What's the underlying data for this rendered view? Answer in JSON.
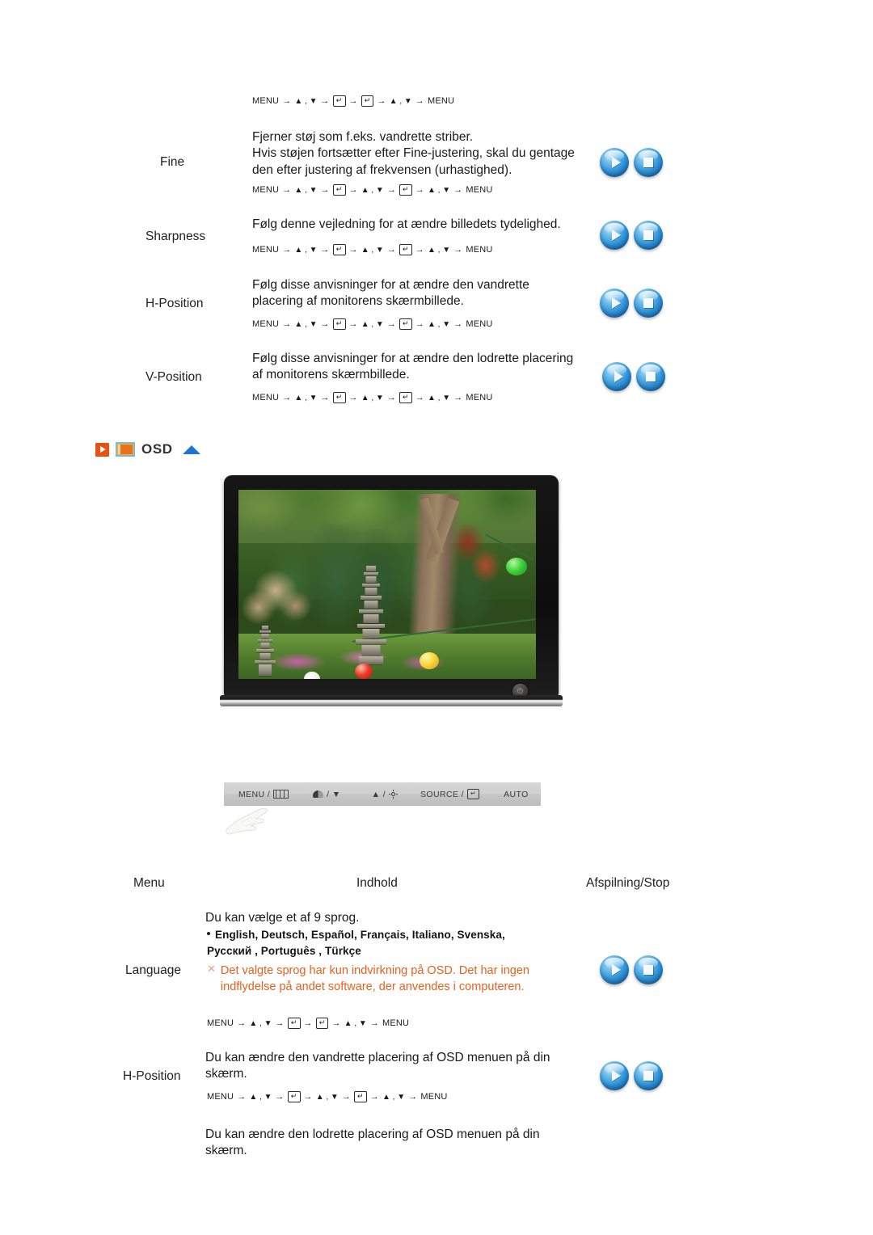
{
  "colors": {
    "accent_orange": "#e8510f",
    "warning_orange": "#e8601c",
    "button_blue": "#2f93d8",
    "triangle_blue": "#1b75d1"
  },
  "top_path": "MENU → ▲ , ▼ → ⏎ → ⏎ → ▲ , ▼ → MENU",
  "rows_top": [
    {
      "menu": "Fine",
      "desc": "Fjerner støj som f.eks. vandrette striber.\nHvis støjen fortsætter efter Fine-justering, skal du gentage den efter justering af frekvensen (urhastighed).",
      "path_type": "long",
      "buttons": [
        "play",
        "stop"
      ]
    },
    {
      "menu": "Sharpness",
      "desc": "Følg denne vejledning for at ændre billedets tydelighed.",
      "path_type": "long",
      "buttons": [
        "play",
        "stop"
      ]
    },
    {
      "menu": "H-Position",
      "desc": "Følg disse anvisninger for at ændre den vandrette placering af monitorens skærmbillede.",
      "path_type": "long",
      "buttons": [
        "play",
        "stop"
      ]
    },
    {
      "menu": "V-Position",
      "desc": "Følg disse anvisninger for at ændre den lodrette placering af monitorens skærmbillede.",
      "path_type": "long",
      "buttons": [
        "play",
        "stop"
      ]
    }
  ],
  "section": {
    "title": "OSD",
    "play_icon": "play-square-icon",
    "monitor_icon": "monitor-icon",
    "up_icon": "up-triangle-icon"
  },
  "monitor": {
    "alt": "monitor displaying garden photo with stone pagoda and paper lanterns",
    "power_icon": "power-icon"
  },
  "control_bar": {
    "items": [
      {
        "label": "MENU /",
        "icon": "osd-menu-icon"
      },
      {
        "label": "/ ▼",
        "icon": "contrast-icon"
      },
      {
        "label": "▲ /",
        "icon": "brightness-icon"
      },
      {
        "label": "SOURCE /",
        "icon": "enter-key-icon"
      },
      {
        "label": "AUTO",
        "icon": ""
      }
    ],
    "hand_icon": "pointing-hand-icon"
  },
  "table_headers": {
    "menu": "Menu",
    "content": "Indhold",
    "play_stop": "Afspilning/Stop"
  },
  "rows_bottom": [
    {
      "menu": "Language",
      "desc": "Du kan vælge et af 9 sprog.",
      "languages": "English, Deutsch, Español, Français,  Italiano, Svenska,\nPусский , Português , Türkçe",
      "warning": "Det valgte sprog har kun indvirkning på OSD. Det har ingen indflydelse på andet software, der anvendes i computeren.",
      "warning_marker": "✕",
      "path_type": "short",
      "buttons": [
        "play",
        "stop"
      ]
    },
    {
      "menu": "H-Position",
      "desc": "Du kan ændre den vandrette placering af OSD menuen på din skærm.",
      "path_type": "long",
      "buttons": [
        "play",
        "stop"
      ]
    },
    {
      "menu": "",
      "desc": "Du kan ændre den lodrette placering af OSD menuen på din skærm.",
      "path_type": "none",
      "buttons": []
    }
  ],
  "path_tokens": {
    "menu": "MENU",
    "arrow": "→",
    "updown": "▲ , ▼",
    "enter": "↵"
  }
}
